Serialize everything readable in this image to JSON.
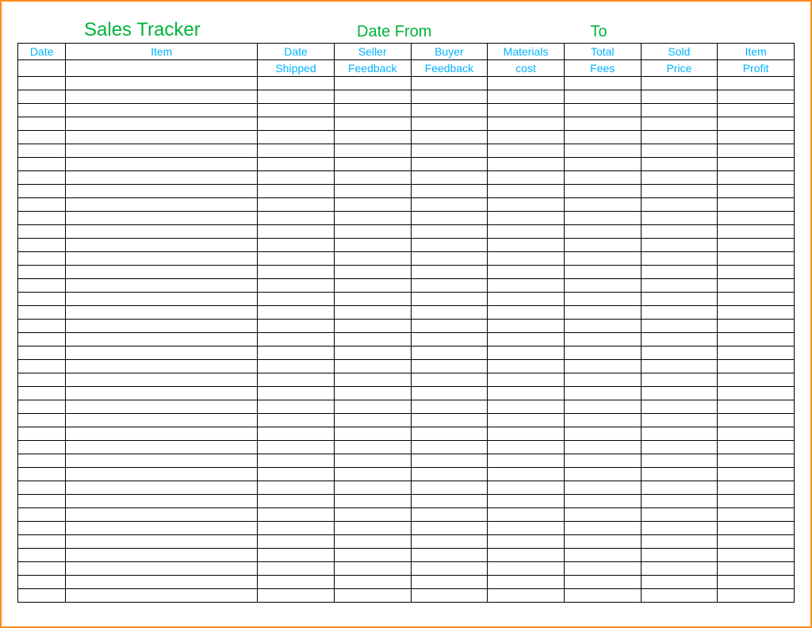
{
  "title": {
    "main": "Sales Tracker",
    "date_from": "Date From",
    "to": "To"
  },
  "columns": {
    "row1": [
      "Date",
      "Item",
      "Date",
      "Seller",
      "Buyer",
      "Materials",
      "Total",
      "Sold",
      "Item"
    ],
    "row2": [
      "",
      "",
      "Shipped",
      "Feedback",
      "Feedback",
      "cost",
      "Fees",
      "Price",
      "Profit"
    ]
  },
  "rows": [
    [
      "",
      "",
      "",
      "",
      "",
      "",
      "",
      "",
      ""
    ],
    [
      "",
      "",
      "",
      "",
      "",
      "",
      "",
      "",
      ""
    ],
    [
      "",
      "",
      "",
      "",
      "",
      "",
      "",
      "",
      ""
    ],
    [
      "",
      "",
      "",
      "",
      "",
      "",
      "",
      "",
      ""
    ],
    [
      "",
      "",
      "",
      "",
      "",
      "",
      "",
      "",
      ""
    ],
    [
      "",
      "",
      "",
      "",
      "",
      "",
      "",
      "",
      ""
    ],
    [
      "",
      "",
      "",
      "",
      "",
      "",
      "",
      "",
      ""
    ],
    [
      "",
      "",
      "",
      "",
      "",
      "",
      "",
      "",
      ""
    ],
    [
      "",
      "",
      "",
      "",
      "",
      "",
      "",
      "",
      ""
    ],
    [
      "",
      "",
      "",
      "",
      "",
      "",
      "",
      "",
      ""
    ],
    [
      "",
      "",
      "",
      "",
      "",
      "",
      "",
      "",
      ""
    ],
    [
      "",
      "",
      "",
      "",
      "",
      "",
      "",
      "",
      ""
    ],
    [
      "",
      "",
      "",
      "",
      "",
      "",
      "",
      "",
      ""
    ],
    [
      "",
      "",
      "",
      "",
      "",
      "",
      "",
      "",
      ""
    ],
    [
      "",
      "",
      "",
      "",
      "",
      "",
      "",
      "",
      ""
    ],
    [
      "",
      "",
      "",
      "",
      "",
      "",
      "",
      "",
      ""
    ],
    [
      "",
      "",
      "",
      "",
      "",
      "",
      "",
      "",
      ""
    ],
    [
      "",
      "",
      "",
      "",
      "",
      "",
      "",
      "",
      ""
    ],
    [
      "",
      "",
      "",
      "",
      "",
      "",
      "",
      "",
      ""
    ],
    [
      "",
      "",
      "",
      "",
      "",
      "",
      "",
      "",
      ""
    ],
    [
      "",
      "",
      "",
      "",
      "",
      "",
      "",
      "",
      ""
    ],
    [
      "",
      "",
      "",
      "",
      "",
      "",
      "",
      "",
      ""
    ],
    [
      "",
      "",
      "",
      "",
      "",
      "",
      "",
      "",
      ""
    ],
    [
      "",
      "",
      "",
      "",
      "",
      "",
      "",
      "",
      ""
    ],
    [
      "",
      "",
      "",
      "",
      "",
      "",
      "",
      "",
      ""
    ],
    [
      "",
      "",
      "",
      "",
      "",
      "",
      "",
      "",
      ""
    ],
    [
      "",
      "",
      "",
      "",
      "",
      "",
      "",
      "",
      ""
    ],
    [
      "",
      "",
      "",
      "",
      "",
      "",
      "",
      "",
      ""
    ],
    [
      "",
      "",
      "",
      "",
      "",
      "",
      "",
      "",
      ""
    ],
    [
      "",
      "",
      "",
      "",
      "",
      "",
      "",
      "",
      ""
    ],
    [
      "",
      "",
      "",
      "",
      "",
      "",
      "",
      "",
      ""
    ],
    [
      "",
      "",
      "",
      "",
      "",
      "",
      "",
      "",
      ""
    ],
    [
      "",
      "",
      "",
      "",
      "",
      "",
      "",
      "",
      ""
    ],
    [
      "",
      "",
      "",
      "",
      "",
      "",
      "",
      "",
      ""
    ],
    [
      "",
      "",
      "",
      "",
      "",
      "",
      "",
      "",
      ""
    ],
    [
      "",
      "",
      "",
      "",
      "",
      "",
      "",
      "",
      ""
    ],
    [
      "",
      "",
      "",
      "",
      "",
      "",
      "",
      "",
      ""
    ],
    [
      "",
      "",
      "",
      "",
      "",
      "",
      "",
      "",
      ""
    ],
    [
      "",
      "",
      "",
      "",
      "",
      "",
      "",
      "",
      ""
    ]
  ]
}
